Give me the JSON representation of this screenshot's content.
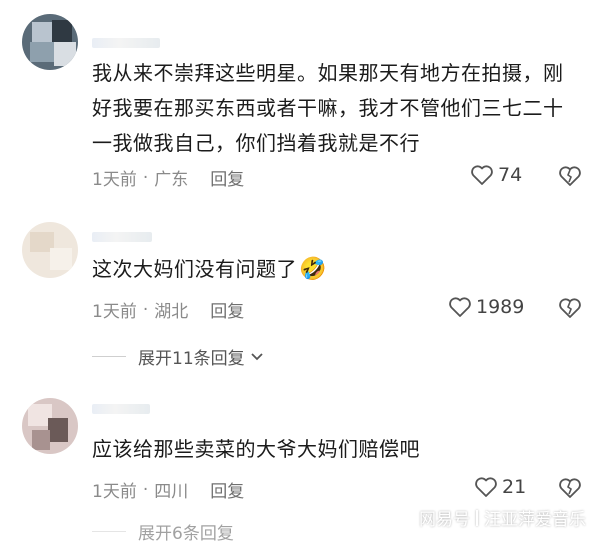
{
  "comments": [
    {
      "text": "我从来不崇拜这些明星。如果那天有地方在拍摄，刚好我要在那买东西或者干嘛，我才不管他们三七二十一我做我自己，你们挡着我就是不行",
      "time": "1天前",
      "location": "广东",
      "reply_label": "回复",
      "likes": "74"
    },
    {
      "text": "这次大妈们没有问题了",
      "emoji": "🤣",
      "time": "1天前",
      "location": "湖北",
      "reply_label": "回复",
      "likes": "1989",
      "expand_label": "展开11条回复"
    },
    {
      "text": "应该给那些卖菜的大爷大妈们赔偿吧",
      "time": "1天前",
      "location": "四川",
      "reply_label": "回复",
      "likes": "21",
      "expand_label": "展开6条回复"
    }
  ],
  "separator": "·",
  "watermark": {
    "source": "网易号",
    "author": "汪亚萍爱音乐"
  },
  "colors": {
    "text": "#1b1b1b",
    "meta": "#8a8a8a",
    "background": "#ffffff"
  },
  "icons": {
    "like": "heart-outline-icon",
    "dislike": "broken-heart-icon",
    "expand": "chevron-down-icon"
  }
}
